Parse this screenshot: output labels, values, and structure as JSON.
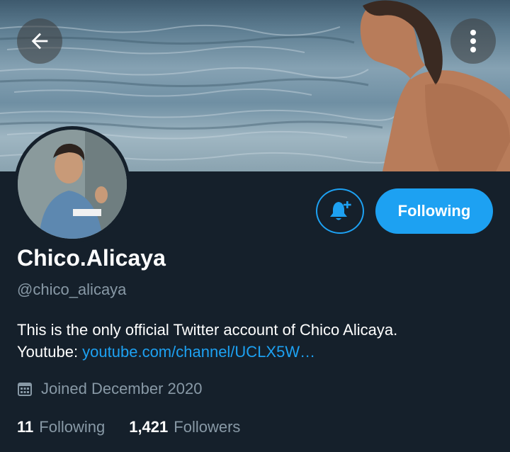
{
  "header": {
    "back_icon": "arrow-left-icon",
    "menu_icon": "vertical-dots-icon"
  },
  "profile": {
    "name": "Chico.Alicaya",
    "handle": "@chico_alicaya",
    "bio_text": "This is the only official Twitter account of Chico Alicaya.",
    "bio_link_prefix": "Youtube: ",
    "bio_link": "youtube.com/channel/UCLX5W…",
    "joined": "Joined December 2020"
  },
  "actions": {
    "notify_icon": "bell-plus-icon",
    "following_label": "Following"
  },
  "stats": {
    "following_count": "11",
    "following_label": "Following",
    "followers_count": "1,421",
    "followers_label": "Followers"
  },
  "colors": {
    "background": "#15202b",
    "accent": "#1da1f2",
    "muted": "#8899a6"
  }
}
